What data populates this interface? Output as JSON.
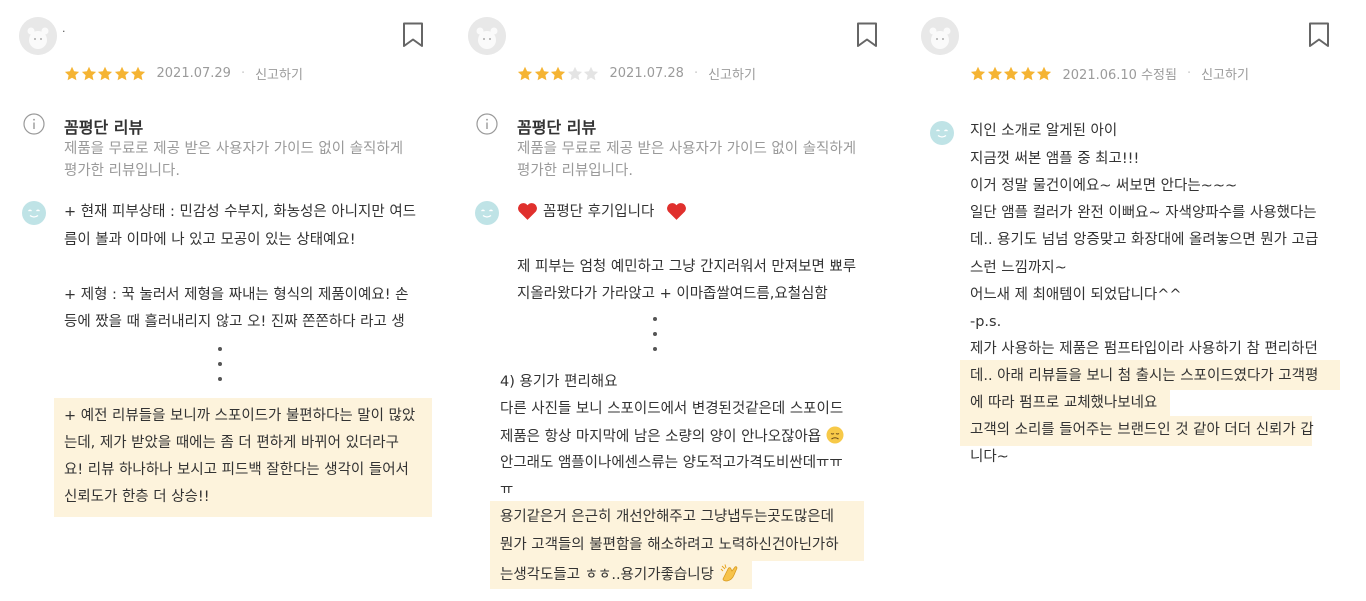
{
  "colors": {
    "star": "#f5b433",
    "star_empty": "#e4e4e4",
    "highlight": "#fdf3dc",
    "face": "#bfe3e6",
    "meta_text": "#9b9b9b"
  },
  "reviews": [
    {
      "username": ".",
      "rating": 5,
      "date": "2021.07.29",
      "report": "신고하기",
      "notice_title": "꼼평단 리뷰",
      "notice_desc": [
        "제품을 무료로 제공 받은 사용자가 가이드 없이 솔직하게",
        "평가한 리뷰입니다."
      ],
      "lines_a": [
        "+ 현재 피부상태 : 민감성 수부지, 화농성은 아니지만 여드",
        "름이 볼과 이마에 나 있고 모공이 있는 상태예요!",
        "+ 제형 : 꾹 눌러서 제형을 짜내는 형식의 제품이예요! 손",
        "등에 짰을 때 흘러내리지 않고 오! 진짜 쫀쫀하다 라고 생"
      ],
      "lines_b": [
        "+ 예전 리뷰들을 보니까 스포이드가 불편하다는 말이 많았",
        "는데, 제가 받았을 때에는 좀 더 편하게 바뀌어 있더라구",
        "요! 리뷰 하나하나 보시고 피드백 잘한다는 생각이 들어서",
        "신뢰도가 한층 더 상승!!"
      ]
    },
    {
      "rating": 3,
      "date": "2021.07.28",
      "report": "신고하기",
      "notice_title": "꼼평단 리뷰",
      "notice_desc": [
        "제품을 무료로 제공 받은 사용자가 가이드 없이 솔직하게",
        "평가한 리뷰입니다."
      ],
      "heading": "꼼평단 후기입니다",
      "lines_a": [
        "제 피부는 엄청 예민하고 그냥 간지러워서 만져보면 뾰루",
        "지올라왔다가 가라앉고 + 이마좁쌀여드름,요철심함"
      ],
      "lines_b": [
        "4) 용기가 편리해요",
        "다른 사진들 보니 스포이드에서 변경된것같은데 스포이드",
        "제품은 항상 마지막에 남은 소량의 양이 안나오잖아욥",
        "안그래도 앰플이나에센스류는 양도적고가격도비싼데ㅠㅠ",
        "ㅠ"
      ],
      "lines_c": [
        "용기같은거 은근히 개선안해주고 그냥냅두는곳도많은데",
        "뭔가 고객들의 불편함을 해소하려고 노력하신건아닌가하",
        "는생각도들고 ㅎㅎ..용기가좋습니당"
      ]
    },
    {
      "rating": 5,
      "date": "2021.06.10 수정됨",
      "report": "신고하기",
      "lines_a": [
        "지인 소개로 알게된 아이",
        "지금껏 써본 앰플 중 최고!!!",
        "이거 정말 물건이에요~ 써보면 안다는~~~",
        "일단 앰플 컬러가 완전 이뻐요~ 자색양파수를 사용했다는",
        "데.. 용기도 넘넘 앙증맞고 화장대에 올려놓으면 뭔가 고급",
        "스런 느낌까지~",
        "어느새 제 최애템이 되었답니다^^",
        "-p.s.",
        "제가 사용하는 제품은 펌프타입이라 사용하기 참 편리하던"
      ],
      "lines_b": [
        "데.. 아래 리뷰들을 보니 첨 출시는 스포이드였다가 고객평",
        "에 따라 펌프로 교체했나보네요",
        "고객의 소리를 들어주는 브랜드인 것 같아 더더 신뢰가 갑",
        "니다~"
      ]
    }
  ]
}
